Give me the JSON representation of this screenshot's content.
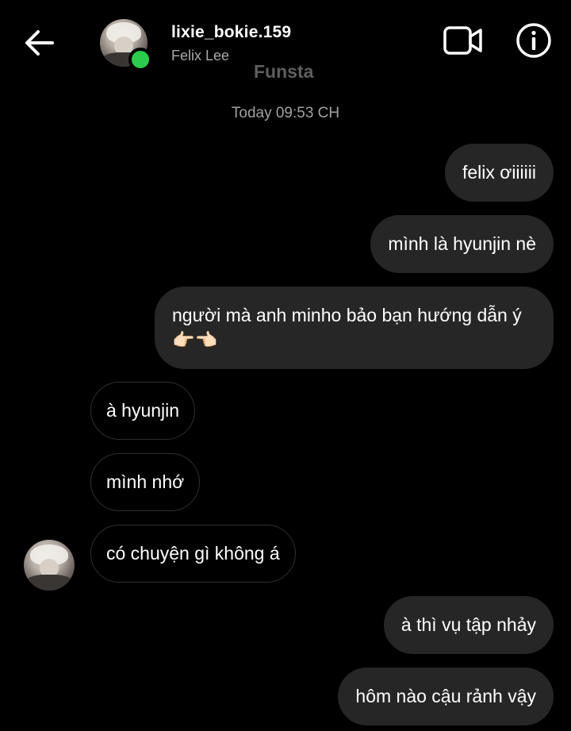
{
  "header": {
    "username": "lixie_bokie.159",
    "full_name": "Felix Lee",
    "account_label": "Funsta",
    "icons": {
      "back": "arrow-left-icon",
      "video": "video-call-icon",
      "info": "info-icon"
    },
    "online_status_color": "#2bcb4e"
  },
  "conversation": {
    "timestamp": "Today 09:53 CH",
    "messages": [
      {
        "side": "sent",
        "text": "felix ơiiiiii"
      },
      {
        "side": "sent",
        "text": "mình là hyunjin nè"
      },
      {
        "side": "sent",
        "text": "người mà anh minho bảo bạn hướng dẫn ý 👉🏻👈🏻"
      },
      {
        "side": "received",
        "text": "à hyunjin"
      },
      {
        "side": "received",
        "text": "mình nhớ"
      },
      {
        "side": "received",
        "text": "có chuyện gì không á"
      },
      {
        "side": "sent",
        "text": "à thì vụ tập nhảy"
      },
      {
        "side": "sent",
        "text": "hôm nào cậu rảnh vậy"
      }
    ]
  },
  "colors": {
    "background": "#000000",
    "sent_bubble": "#262626",
    "received_border": "#2f2f2f",
    "secondary_text": "#a8a8a8"
  }
}
